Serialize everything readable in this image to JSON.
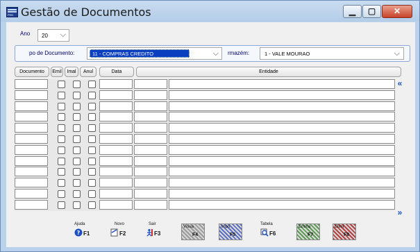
{
  "window": {
    "title": "Gestão de Documentos",
    "icon_label": "PHC"
  },
  "controls": {
    "minimize": "▁",
    "maximize": "▢",
    "close": "✕"
  },
  "filters": {
    "ano_label": "Ano",
    "ano_value": "20",
    "tipo_label": "po de Documento:",
    "tipo_value": "11 - COMPRAS CREDITO",
    "armazem_label": "rmazém:",
    "armazem_value": "1 - VALE MOURAO"
  },
  "columns": [
    "Documento",
    "Emil",
    "Imal",
    "Anul",
    "Data",
    "",
    "Entidade"
  ],
  "rows": 12,
  "toolbar": [
    {
      "caption": "Ajuda",
      "key": "F1",
      "icon": "help-icon"
    },
    {
      "caption": "Novo",
      "key": "F2",
      "icon": "new-document-icon"
    },
    {
      "caption": "Sair",
      "key": "F3",
      "icon": "exit-icon"
    },
    {
      "caption": "Visua",
      "key": "F4",
      "icon": "view-icon",
      "disabled": true
    },
    {
      "caption": "Impri",
      "key": "F5",
      "icon": "print-icon",
      "disabled": true
    },
    {
      "caption": "Tabela",
      "key": "F6",
      "icon": "table-search-icon"
    },
    {
      "caption": "Emma",
      "key": "F7",
      "icon": "email-icon",
      "disabled": true
    },
    {
      "caption": "Elimi",
      "key": "F8",
      "icon": "delete-icon",
      "disabled": true
    }
  ],
  "colors": {
    "accent": "#0a3fbf",
    "frame": "#b9d1ea",
    "scroll": "#1b4fc8"
  }
}
